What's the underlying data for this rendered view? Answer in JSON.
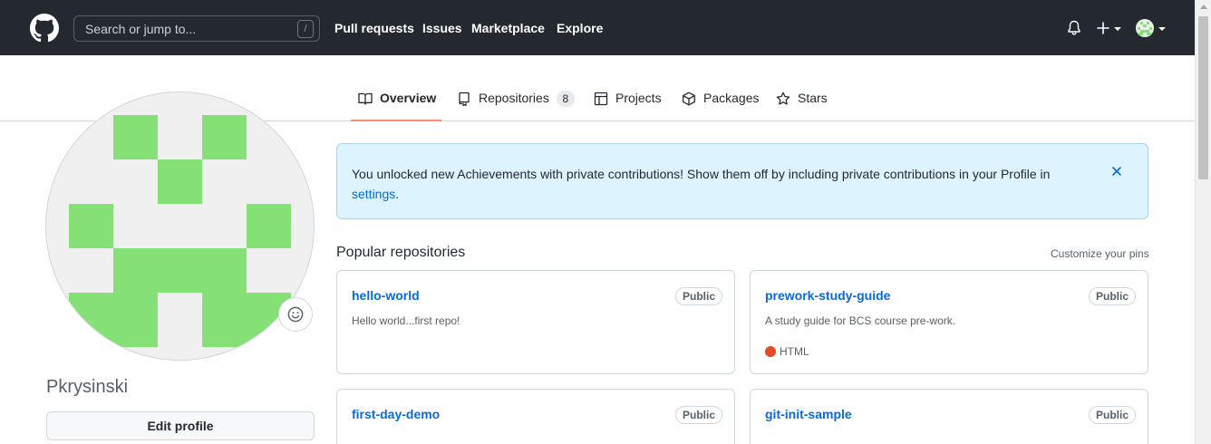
{
  "header": {
    "search_placeholder": "Search or jump to...",
    "slash_key": "/",
    "nav": [
      "Pull requests",
      "Issues",
      "Marketplace",
      "Explore"
    ]
  },
  "tabs": [
    {
      "label": "Overview",
      "selected": true,
      "icon": "book-icon"
    },
    {
      "label": "Repositories",
      "count": "8",
      "icon": "repo-icon"
    },
    {
      "label": "Projects",
      "icon": "table-icon"
    },
    {
      "label": "Packages",
      "icon": "package-icon"
    },
    {
      "label": "Stars",
      "icon": "star-icon"
    }
  ],
  "profile": {
    "username": "Pkrysinski",
    "edit_button": "Edit profile"
  },
  "flash": {
    "text": "You unlocked new Achievements with private contributions! Show them off by including private contributions in your Profile in",
    "link": "settings",
    "end": "."
  },
  "popular": {
    "title": "Popular repositories",
    "customize": "Customize your pins",
    "repos": [
      {
        "name": "hello-world",
        "visibility": "Public",
        "description": "Hello world...first repo!"
      },
      {
        "name": "prework-study-guide",
        "visibility": "Public",
        "description": "A study guide for BCS course pre-work.",
        "language": "HTML",
        "language_color": "#e34c26"
      },
      {
        "name": "first-day-demo",
        "visibility": "Public"
      },
      {
        "name": "git-init-sample",
        "visibility": "Public"
      }
    ]
  },
  "colors": {
    "header_bg": "#24292f",
    "link": "#0969da",
    "tab_underline": "#fd8c73",
    "avatar_green": "#85e075",
    "flash_bg": "#ddf4ff"
  }
}
